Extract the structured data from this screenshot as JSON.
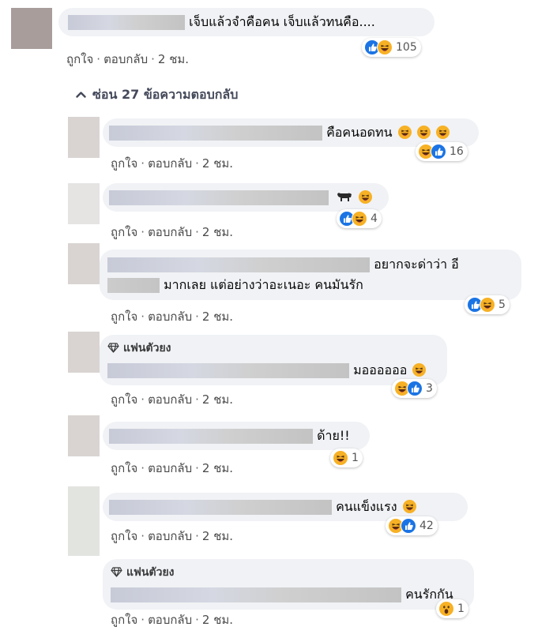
{
  "comment": {
    "text": "เจ็บแล้วจำคือคน เจ็บแล้วทนคือ....",
    "reaction_count": "105",
    "actions": {
      "like": "ถูกใจ",
      "reply": "ตอบกลับ",
      "time": "2 ชม."
    }
  },
  "replies_toggle": {
    "label": "ซ่อน 27 ข้อความตอบกลับ",
    "icon": "chevron-up-icon"
  },
  "replies": [
    {
      "text": "คือคนอดทน",
      "reaction_count": "16"
    },
    {
      "text": "",
      "reaction_count": "4"
    },
    {
      "text_line1": "อยากจะด่าว่า อี",
      "text_line2": "มากเลย แต่อย่างว่าอะเนอะ คนมันรัก",
      "reaction_count": "5"
    },
    {
      "badge": "แฟนตัวยง",
      "text": "มออออออ",
      "reaction_count": "3"
    },
    {
      "text": "ด้าย!!",
      "reaction_count": "1"
    },
    {
      "text": "คนแข็งแรง",
      "reaction_count": "42"
    },
    {
      "badge": "แฟนตัวยง",
      "text": "คนรักกัน",
      "reaction_count": "1"
    }
  ],
  "colors": {
    "like": "#1b74e4",
    "emoji": "#f7b125",
    "bubble": "#f0f2f5"
  }
}
